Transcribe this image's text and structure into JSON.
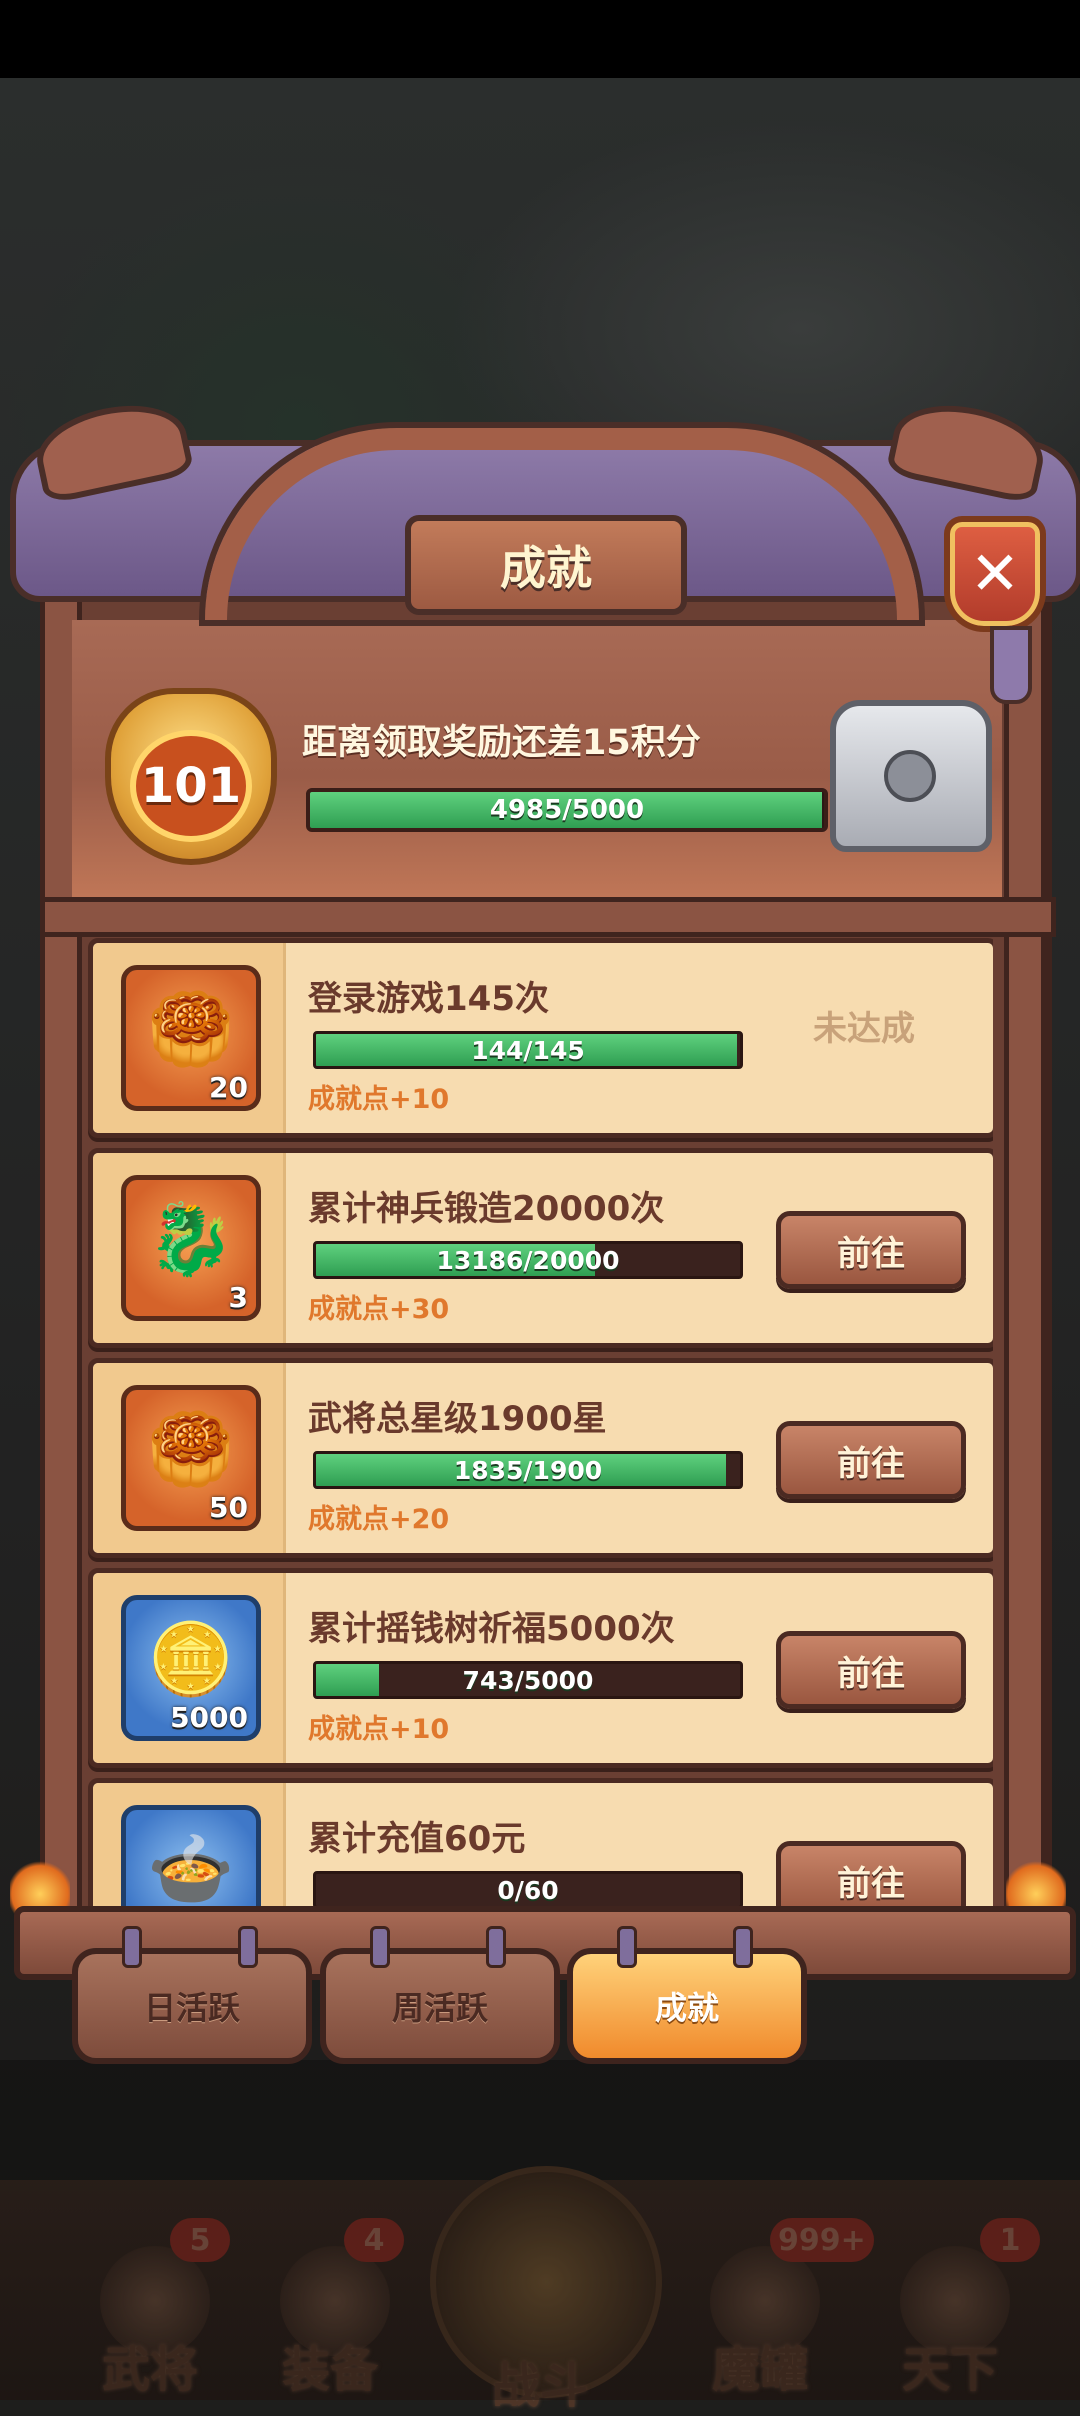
{
  "dialog": {
    "title": "成就",
    "close_icon": "✕",
    "header": {
      "level": "101",
      "message": "距离领取奖励还差15积分",
      "progress_text": "4985/5000",
      "progress": 0.997
    }
  },
  "achievements": [
    {
      "title": "登录游戏145次",
      "progress_text": "144/145",
      "progress": 0.993,
      "points": "成就点+10",
      "reward_icon": "gold-ingot-icon",
      "reward_qty": "20",
      "status": "未达成"
    },
    {
      "title": "累计神兵锻造20000次",
      "progress_text": "13186/20000",
      "progress": 0.659,
      "points": "成就点+30",
      "reward_icon": "dragon-emblem-icon",
      "reward_qty": "3",
      "action": "前往"
    },
    {
      "title": "武将总星级1900星",
      "progress_text": "1835/1900",
      "progress": 0.966,
      "points": "成就点+20",
      "reward_icon": "gold-ingot-icon",
      "reward_qty": "50",
      "action": "前往"
    },
    {
      "title": "累计摇钱树祈福5000次",
      "progress_text": "743/5000",
      "progress": 0.149,
      "points": "成就点+10",
      "reward_icon": "coin-icon",
      "reward_qty": "5000",
      "action": "前往"
    },
    {
      "title": "累计充值60元",
      "progress_text": "0/60",
      "progress": 0,
      "points": "",
      "reward_icon": "jade-bowl-icon",
      "reward_qty": "",
      "action": "前往"
    }
  ],
  "tabs": [
    {
      "label": "日活跃",
      "active": false
    },
    {
      "label": "周活跃",
      "active": false
    },
    {
      "label": "成就",
      "active": true
    }
  ],
  "bottom_nav": [
    {
      "label": "武将",
      "badge": "5"
    },
    {
      "label": "装备",
      "badge": "4"
    },
    {
      "label": "战斗",
      "badge": ""
    },
    {
      "label": "魔罐",
      "badge": "999+"
    },
    {
      "label": "天下",
      "badge": "1"
    }
  ],
  "colors": {
    "progress_fill": "#3faa5c",
    "points_text": "#e0782c",
    "active_tab": "#f5a23c"
  }
}
